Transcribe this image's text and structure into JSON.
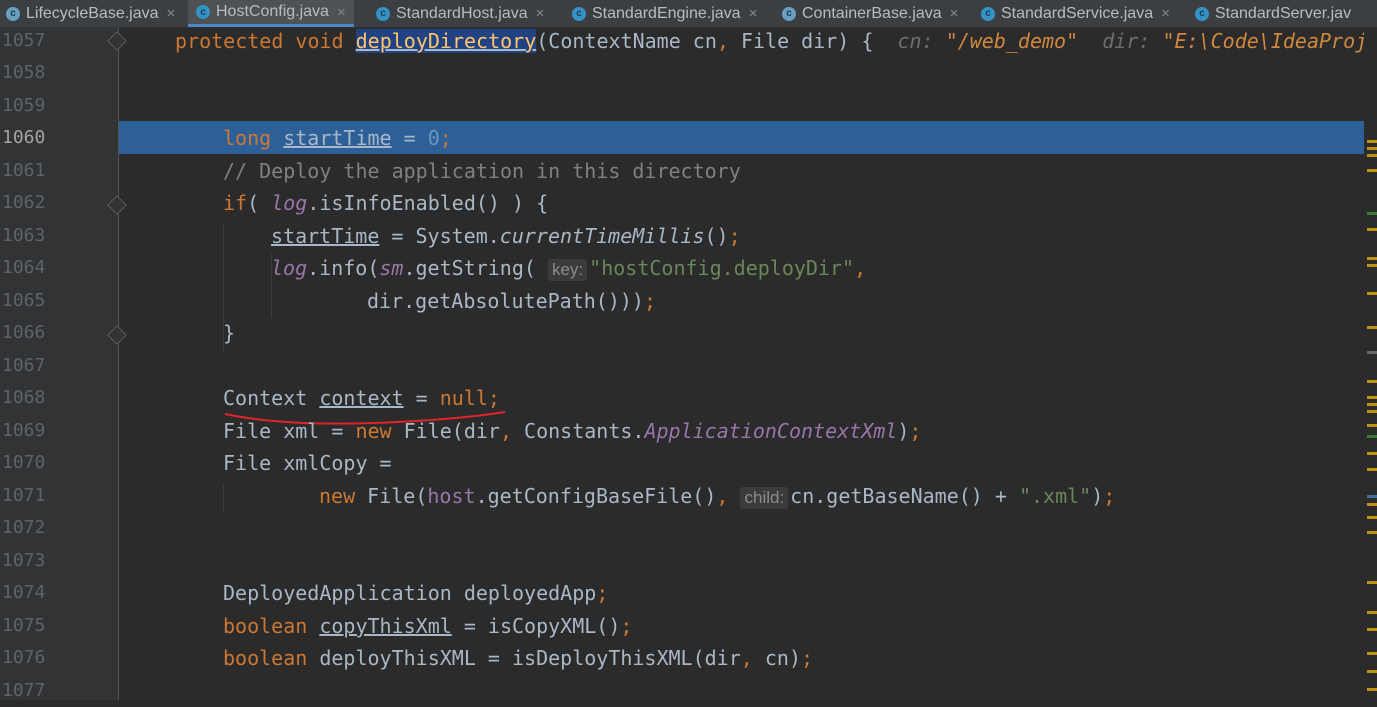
{
  "tabs": [
    {
      "label": "LifecycleBase.java",
      "icon": "abstract-class-icon"
    },
    {
      "label": "HostConfig.java",
      "icon": "class-icon",
      "active": true
    },
    {
      "label": "StandardHost.java",
      "icon": "class-icon"
    },
    {
      "label": "StandardEngine.java",
      "icon": "class-icon"
    },
    {
      "label": "ContainerBase.java",
      "icon": "abstract-class-icon"
    },
    {
      "label": "StandardService.java",
      "icon": "class-icon"
    },
    {
      "label": "StandardServer.jav",
      "icon": "class-icon"
    }
  ],
  "close_glyph": "×",
  "line_numbers": [
    "1057",
    "1058",
    "1059",
    "1060",
    "1061",
    "1062",
    "1063",
    "1064",
    "1065",
    "1066",
    "1067",
    "1068",
    "1069",
    "1070",
    "1071",
    "1072",
    "1073",
    "1074",
    "1075",
    "1076",
    "1077"
  ],
  "current_line": "1060",
  "code": {
    "l1057": {
      "kw1": "protected void ",
      "method": "deployDirectory",
      "sig": "(ContextName cn",
      "comma1": ", ",
      "sig2": "File dir) {",
      "dbg1_label": "cn: ",
      "dbg1_value": "\"/web_demo\"",
      "dbg2_label": "dir: ",
      "dbg2_value": "\"E:\\Code\\IdeaProje"
    },
    "l1060": {
      "kw": "long ",
      "var": "startTime",
      "op": " = ",
      "num": "0",
      "semi": ";"
    },
    "l1061": {
      "comment": "// Deploy the application in this directory"
    },
    "l1062": {
      "kw": "if",
      "p1": "( ",
      "fld": "log",
      "rest": ".isInfoEnabled() ) {"
    },
    "l1063": {
      "var": "startTime",
      "op": " = System.",
      "call": "currentTimeMillis",
      "rest": "()",
      "semi": ";"
    },
    "l1064": {
      "fld": "log",
      "a": ".info(",
      "fld2": "sm",
      "b": ".getString( ",
      "hint": "key:",
      "str": "\"hostConfig.deployDir\"",
      "comma": ","
    },
    "l1065": {
      "text": "dir.getAbsolutePath()))",
      "semi": ";"
    },
    "l1066": {
      "text": "}"
    },
    "l1068": {
      "type": "Context ",
      "var": "context",
      "op": " = ",
      "kw": "null",
      "semi": ";"
    },
    "l1069": {
      "a": "File xml = ",
      "kw": "new ",
      "b": "File(dir",
      "comma": ", ",
      "c": "Constants.",
      "fld": "ApplicationContextXml",
      "d": ")",
      "semi": ";"
    },
    "l1070": {
      "text": "File xmlCopy ="
    },
    "l1071": {
      "kw": "new ",
      "a": "File(",
      "fld": "host",
      "b": ".getConfigBaseFile()",
      "comma": ", ",
      "hint": "child:",
      "c": "cn.getBaseName() + ",
      "str": "\".xml\"",
      "d": ")",
      "semi": ";"
    },
    "l1074": {
      "text": "DeployedApplication deployedApp",
      "semi": ";"
    },
    "l1075": {
      "kw": "boolean ",
      "var": "copyThisXml",
      "op": " = isCopyXML()",
      "semi": ";"
    },
    "l1076": {
      "kw": "boolean ",
      "a": "deployThisXML = isDeployThisXML(dir",
      "comma": ", ",
      "b": "cn)",
      "semi": ";"
    }
  },
  "colors": {
    "keyword": "#cc7832",
    "number": "#6897bb",
    "string": "#6a8759",
    "comment": "#808080",
    "field": "#9876aa",
    "highlight": "#2d5f99",
    "annotation": "#e0242b"
  }
}
